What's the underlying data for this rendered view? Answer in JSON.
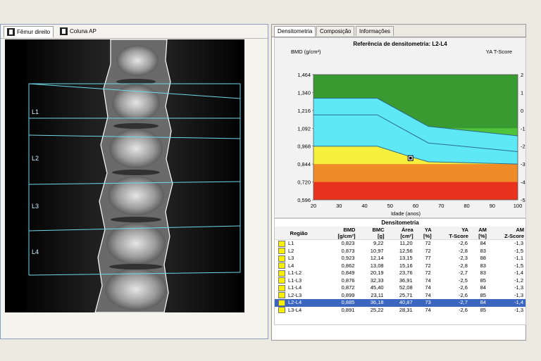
{
  "left_tabs": [
    {
      "label": "Fêmur direito",
      "icon": "femur-icon"
    },
    {
      "label": "Coluna AP",
      "icon": "spine-icon"
    }
  ],
  "vertebra_labels": [
    "L1",
    "L2",
    "L3",
    "L4"
  ],
  "right_tabs": [
    "Densitometria",
    "Composição",
    "Informações"
  ],
  "chart_data": {
    "type": "area",
    "title": "Referência de densitometria: L2-L4",
    "ylabel": "BMD (g/cm²)",
    "y2label": "YA T-Score",
    "xlabel": "Idade (anos)",
    "xlim": [
      20,
      100
    ],
    "ylim": [
      0.596,
      1.464
    ],
    "x_ticks": [
      "20",
      "30",
      "40",
      "50",
      "60",
      "70",
      "80",
      "90",
      "100"
    ],
    "y_ticks": [
      "1,464",
      "1,340",
      "1,216",
      "1,092",
      "0,968",
      "0,844",
      "0,720",
      "0,596"
    ],
    "y2_ticks": [
      "2",
      "1",
      "0",
      "-1",
      "-2",
      "-3",
      "-4",
      "-5"
    ],
    "bands": [
      {
        "name": "red",
        "color": "#e8321e",
        "upper": [
          [
            20,
            0.72
          ],
          [
            100,
            0.72
          ]
        ]
      },
      {
        "name": "orange",
        "color": "#f08c28",
        "upper": [
          [
            20,
            0.844
          ],
          [
            100,
            0.844
          ]
        ]
      },
      {
        "name": "yellow",
        "color": "#f5f03c",
        "upper": [
          [
            20,
            0.968
          ],
          [
            45,
            0.968
          ],
          [
            58,
            0.895
          ],
          [
            65,
            0.86
          ],
          [
            100,
            0.844
          ]
        ]
      },
      {
        "name": "cyan",
        "color": "#5ee8f5",
        "upper": [
          [
            20,
            1.3
          ],
          [
            45,
            1.3
          ],
          [
            65,
            1.105
          ],
          [
            100,
            1.04
          ]
        ]
      },
      {
        "name": "green-light",
        "color": "#4fc43a",
        "upper": [
          [
            20,
            1.092
          ],
          [
            100,
            1.092
          ]
        ]
      },
      {
        "name": "green-dark",
        "color": "#3a9a32",
        "upper": [
          [
            20,
            1.464
          ],
          [
            100,
            1.464
          ]
        ]
      }
    ],
    "mean_line": [
      [
        20,
        1.185
      ],
      [
        45,
        1.185
      ],
      [
        65,
        0.99
      ],
      [
        100,
        0.93
      ]
    ],
    "patient_point": {
      "x": 58,
      "y": 0.885
    }
  },
  "table": {
    "title": "Densitometria",
    "headers": [
      [
        "Região",
        ""
      ],
      [
        "BMD",
        "[g/cm²]"
      ],
      [
        "BMC",
        "[g]"
      ],
      [
        "Área",
        "[cm²]"
      ],
      [
        "YA",
        "[%]"
      ],
      [
        "YA",
        "T-Score"
      ],
      [
        "AM",
        "[%]"
      ],
      [
        "AM",
        "Z-Score"
      ]
    ],
    "rows": [
      [
        "L1",
        "0,823",
        "9,22",
        "11,20",
        "72",
        "-2,6",
        "84",
        "-1,3"
      ],
      [
        "L2",
        "0,873",
        "10,97",
        "12,56",
        "72",
        "-2,8",
        "83",
        "-1,5"
      ],
      [
        "L3",
        "0,923",
        "12,14",
        "13,15",
        "77",
        "-2,3",
        "88",
        "-1,1"
      ],
      [
        "L4",
        "0,862",
        "13,08",
        "15,16",
        "72",
        "-2,8",
        "83",
        "-1,5"
      ],
      [
        "L1-L2",
        "0,849",
        "20,19",
        "23,76",
        "72",
        "-2,7",
        "83",
        "-1,4"
      ],
      [
        "L1-L3",
        "0,876",
        "32,33",
        "36,91",
        "74",
        "-2,5",
        "85",
        "-1,2"
      ],
      [
        "L1-L4",
        "0,872",
        "45,40",
        "52,08",
        "74",
        "-2,6",
        "84",
        "-1,3"
      ],
      [
        "L2-L3",
        "0,899",
        "23,11",
        "25,71",
        "74",
        "-2,6",
        "85",
        "-1,3"
      ],
      [
        "L2-L4",
        "0,885",
        "36,18",
        "40,87",
        "73",
        "-2,7",
        "84",
        "-1,4"
      ],
      [
        "L3-L4",
        "0,891",
        "25,22",
        "28,31",
        "74",
        "-2,6",
        "85",
        "-1,3"
      ]
    ],
    "selected_row": 8
  }
}
